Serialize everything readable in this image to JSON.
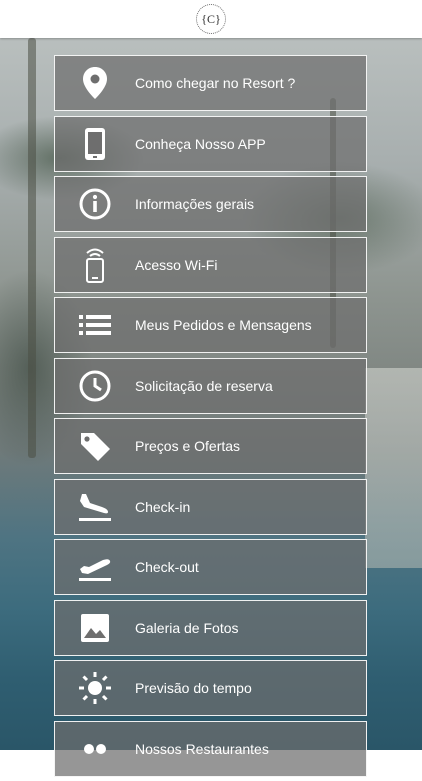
{
  "header": {
    "logo_text": "{C}"
  },
  "menu": {
    "items": [
      {
        "icon": "location-pin-icon",
        "label": "Como chegar no Resort ?"
      },
      {
        "icon": "smartphone-icon",
        "label": "Conheça Nosso APP"
      },
      {
        "icon": "info-icon",
        "label": "Informações gerais"
      },
      {
        "icon": "wifi-phone-icon",
        "label": "Acesso Wi-Fi"
      },
      {
        "icon": "list-icon",
        "label": "Meus Pedidos e Mensagens"
      },
      {
        "icon": "clock-icon",
        "label": "Solicitação de reserva"
      },
      {
        "icon": "price-tag-icon",
        "label": "Preços e Ofertas"
      },
      {
        "icon": "plane-takeoff-icon",
        "label": "Check-in"
      },
      {
        "icon": "plane-landing-icon",
        "label": "Check-out"
      },
      {
        "icon": "photo-gallery-icon",
        "label": "Galeria de Fotos"
      },
      {
        "icon": "sun-icon",
        "label": "Previsão do tempo"
      },
      {
        "icon": "restaurant-icon",
        "label": "Nossos Restaurantes"
      }
    ]
  }
}
